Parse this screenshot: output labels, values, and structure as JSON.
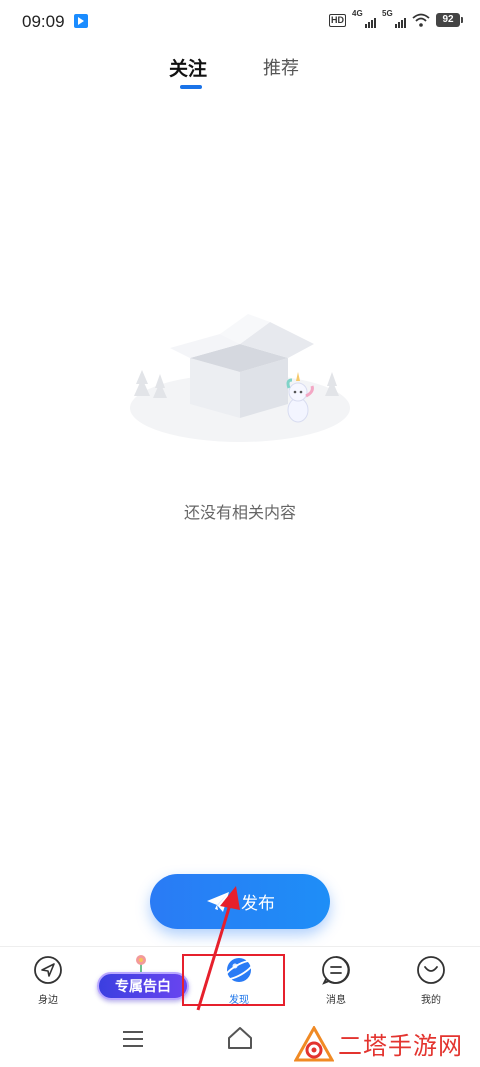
{
  "status_bar": {
    "time": "09:09",
    "hd_label": "HD",
    "network_1": "4G",
    "network_2": "5G",
    "battery": "92"
  },
  "top_tabs": [
    {
      "label": "关注",
      "active": true
    },
    {
      "label": "推荐",
      "active": false
    }
  ],
  "empty_state": {
    "message": "还没有相关内容",
    "illustration": "empty-box-with-unicorn"
  },
  "publish_button": {
    "label": "发布",
    "icon": "paper-plane-icon"
  },
  "promo_badge": {
    "label": "专属告白"
  },
  "bottom_nav": [
    {
      "label": "身边",
      "icon": "navigation-icon"
    },
    {
      "label": "发现",
      "icon": "planet-icon",
      "active": true
    },
    {
      "label": "消息",
      "icon": "message-icon"
    },
    {
      "label": "我的",
      "icon": "profile-icon"
    }
  ],
  "watermark": {
    "text": "二塔手游网"
  },
  "colors": {
    "accent": "#1a73e8",
    "highlight": "#e6202c"
  }
}
